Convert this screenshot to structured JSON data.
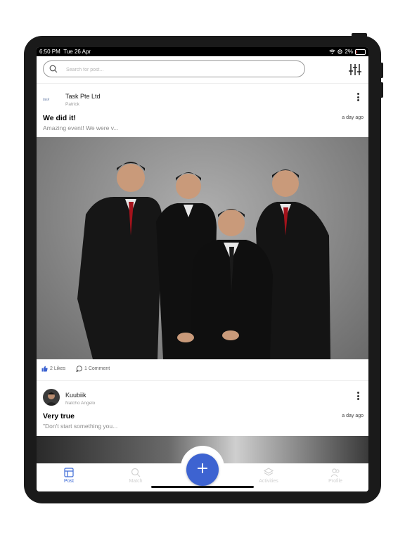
{
  "status_bar": {
    "time": "6:50 PM",
    "date": "Tue 26 Apr",
    "battery": "2%"
  },
  "search": {
    "placeholder": "Search for post..."
  },
  "posts": [
    {
      "company_logo_text": "task",
      "author": "Task Pte Ltd",
      "sub": "Patrick",
      "title": "We did it!",
      "excerpt": "Amazing event! We were v...",
      "date": "a day ago",
      "likes": "2 Likes",
      "comments": "1 Comment"
    },
    {
      "author": "Kuubiik",
      "sub": "Natcho Angelo",
      "title": "Very true",
      "excerpt": "\"Don't start something you...",
      "date": "a day ago"
    }
  ],
  "tabs": [
    {
      "label": "Post",
      "icon": "post-icon",
      "active": true
    },
    {
      "label": "Match",
      "icon": "search-icon",
      "active": false
    },
    {
      "label": "Activities",
      "icon": "layers-icon",
      "active": false
    },
    {
      "label": "Profile",
      "icon": "profile-icon",
      "active": false
    }
  ],
  "fab": {
    "label": "+"
  },
  "colors": {
    "accent": "#3d63d1",
    "tab_active": "#3d6ad6"
  }
}
